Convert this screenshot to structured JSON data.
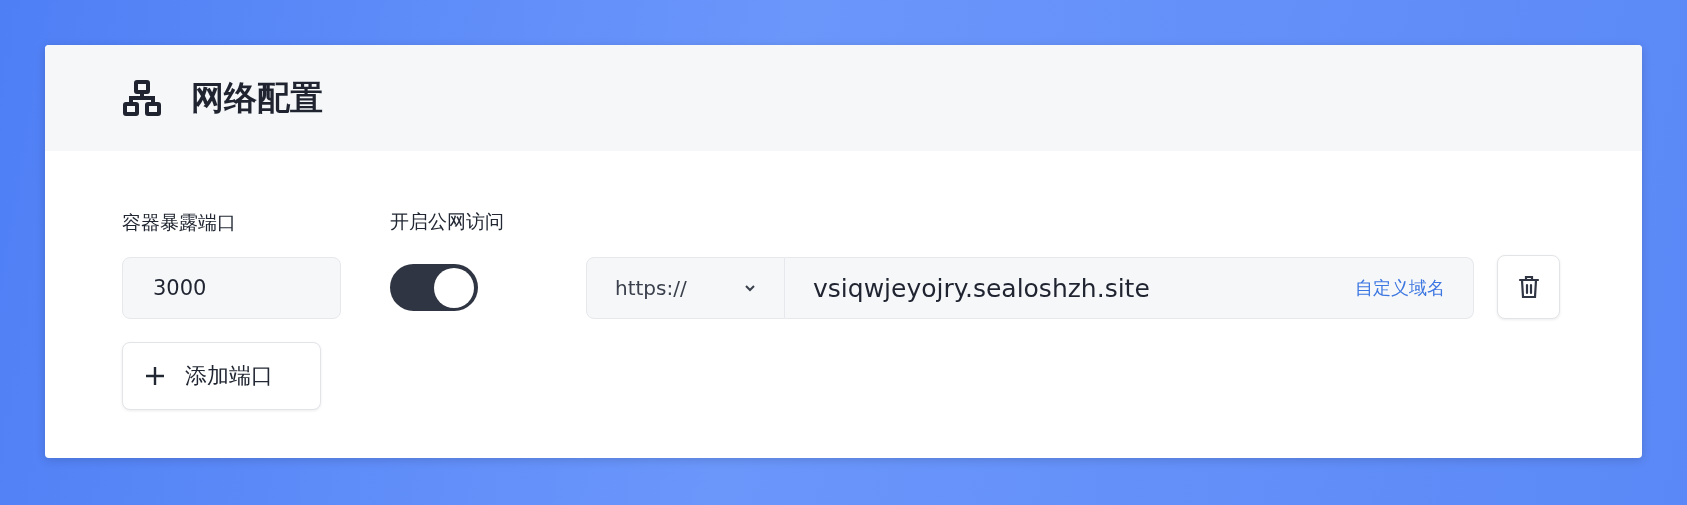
{
  "card": {
    "title": "网络配置"
  },
  "port": {
    "label": "容器暴露端口",
    "value": "3000"
  },
  "public_access": {
    "label": "开启公网访问",
    "on": true
  },
  "protocol": {
    "value": "https://"
  },
  "domain": {
    "value": "vsiqwjeyojry.sealoshzh.site",
    "custom_link": "自定义域名"
  },
  "add_button": {
    "label": "添加端口"
  }
}
